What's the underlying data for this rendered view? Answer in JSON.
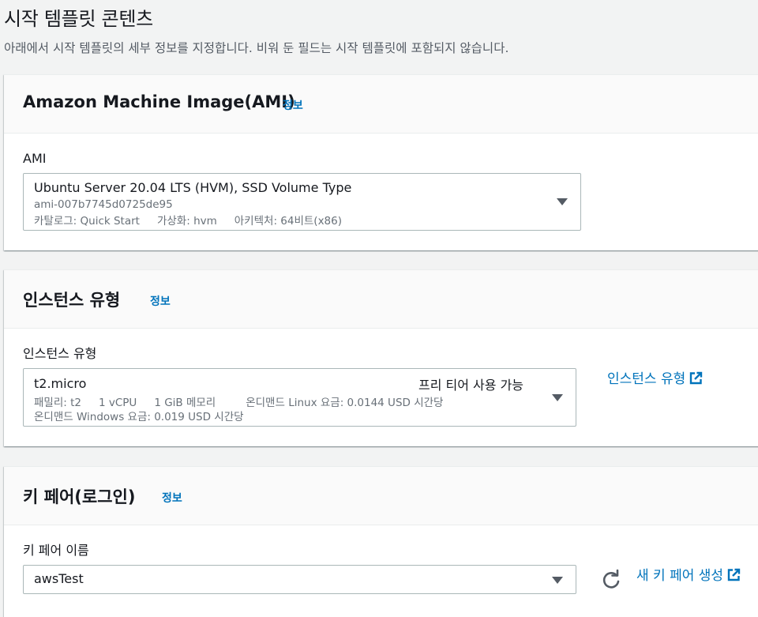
{
  "header": {
    "title": "시작 템플릿 콘텐츠",
    "description": "아래에서 시작 템플릿의 세부 정보를 지정합니다. 비워 둔 필드는 시작 템플릿에 포함되지 않습니다."
  },
  "ami_panel": {
    "title": "Amazon Machine Image(AMI)",
    "info": "정보",
    "field_label": "AMI",
    "selected": {
      "name": "Ubuntu Server 20.04 LTS (HVM), SSD Volume Type",
      "id": "ami-007b7745d0725de95",
      "catalog": "카탈로그: Quick Start",
      "virtualization": "가상화: hvm",
      "architecture": "아키텍처: 64비트(x86)"
    }
  },
  "instance_panel": {
    "title": "인스턴스 유형",
    "info": "정보",
    "field_label": "인스턴스 유형",
    "selected": {
      "name": "t2.micro",
      "badge": "프리 티어 사용 가능",
      "family": "패밀리: t2",
      "vcpu": "1 vCPU",
      "memory": "1 GiB 메모리",
      "linux_price": "온디맨드 Linux 요금: 0.0144 USD 시간당",
      "windows_price": "온디맨드 Windows 요금: 0.019 USD 시간당"
    },
    "external_link": "인스턴스 유형"
  },
  "keypair_panel": {
    "title": "키 페어(로그인)",
    "info": "정보",
    "field_label": "키 페어 이름",
    "selected": "awsTest",
    "create_link": "새 키 페어 생성"
  },
  "icons": {
    "dropdown": "caret-down-icon",
    "external": "external-link-icon",
    "refresh": "refresh-icon"
  },
  "colors": {
    "link": "#0073bb",
    "text": "#16191f",
    "muted": "#687078",
    "border": "#aab7b8"
  }
}
